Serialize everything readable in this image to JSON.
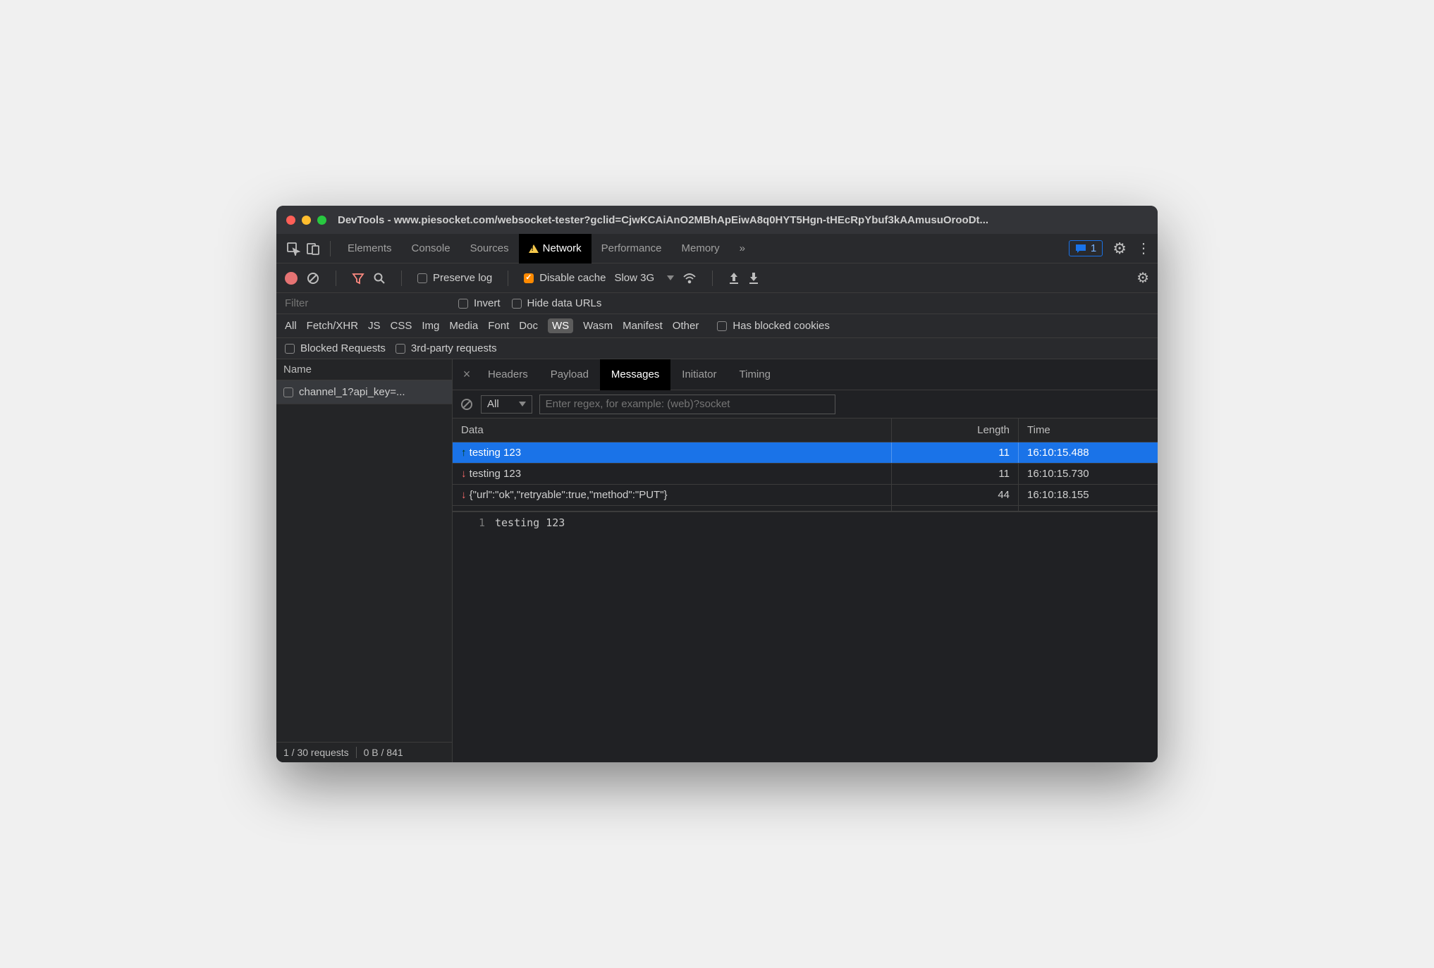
{
  "window": {
    "title": "DevTools - www.piesocket.com/websocket-tester?gclid=CjwKCAiAnO2MBhApEiwA8q0HYT5Hgn-tHEcRpYbuf3kAAmusuOrooDt..."
  },
  "topTabs": {
    "items": [
      "Elements",
      "Console",
      "Sources",
      "Network",
      "Performance",
      "Memory"
    ],
    "active": "Network",
    "more": "»",
    "commentCount": "1"
  },
  "netToolbar": {
    "preserveLog": "Preserve log",
    "disableCache": "Disable cache",
    "throttle": "Slow 3G"
  },
  "filters": {
    "placeholder": "Filter",
    "invert": "Invert",
    "hideDataUrls": "Hide data URLs",
    "types": [
      "All",
      "Fetch/XHR",
      "JS",
      "CSS",
      "Img",
      "Media",
      "Font",
      "Doc",
      "WS",
      "Wasm",
      "Manifest",
      "Other"
    ],
    "activeType": "WS",
    "hasBlockedCookies": "Has blocked cookies",
    "blockedRequests": "Blocked Requests",
    "thirdParty": "3rd-party requests"
  },
  "requests": {
    "nameHeader": "Name",
    "items": [
      {
        "name": "channel_1?api_key=..."
      }
    ],
    "status1": "1 / 30 requests",
    "status2": "0 B / 841"
  },
  "detailTabs": {
    "items": [
      "Headers",
      "Payload",
      "Messages",
      "Initiator",
      "Timing"
    ],
    "active": "Messages"
  },
  "messages": {
    "filterAll": "All",
    "regexPlaceholder": "Enter regex, for example: (web)?socket",
    "headers": {
      "data": "Data",
      "length": "Length",
      "time": "Time"
    },
    "rows": [
      {
        "dir": "up",
        "data": "testing 123",
        "length": "11",
        "time": "16:10:15.488",
        "selected": true
      },
      {
        "dir": "down",
        "data": "testing 123",
        "length": "11",
        "time": "16:10:15.730"
      },
      {
        "dir": "down",
        "data": "{\"url\":\"ok\",\"retryable\":true,\"method\":\"PUT\"}",
        "length": "44",
        "time": "16:10:18.155"
      }
    ],
    "preview": {
      "lineNum": "1",
      "content": "testing 123"
    }
  }
}
